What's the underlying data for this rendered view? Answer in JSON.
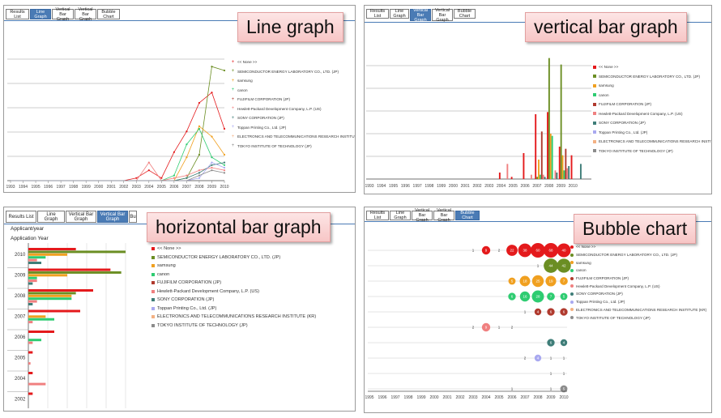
{
  "colors": {
    "tab_active": "#4a7bb5",
    "callout_bg": "#f9d2d2",
    "series": [
      "#e41a1c",
      "#6b8e23",
      "#f0a020",
      "#2ecc71",
      "#b03a2e",
      "#f08080",
      "#3e7d78",
      "#a9a9f0",
      "#f4b183",
      "#8c8c8c"
    ]
  },
  "panels": [
    {
      "tabs": [
        "Results List",
        "Line Graph",
        "Vertical Bar Graph",
        "Vertical Bar Graph",
        "Bubble Chart"
      ],
      "active_tab": 1,
      "callout": "Line graph"
    },
    {
      "tabs": [
        "Results List",
        "Line Graph",
        "Vertical Bar Graph",
        "Vertical Bar Graph",
        "Bubble Chart"
      ],
      "active_tab": 2,
      "callout": "vertical bar graph"
    },
    {
      "tabs": [
        "Results List",
        "Line Graph",
        "Vertical Bar Graph",
        "Vertical Bar Graph",
        "Bu"
      ],
      "active_tab": 3,
      "callout": "horizontal bar graph",
      "title1": "Applicant/year",
      "title2": "Application Year"
    },
    {
      "tabs": [
        "Results List",
        "Line Graph",
        "Vertical Bar Graph",
        "Vertical Bar Graph",
        "Bubble Chart"
      ],
      "active_tab": 4,
      "callout": "Bubble chart"
    }
  ],
  "legend": [
    "<< None >>",
    "SEMICONDUCTOR ENERGY LABORATORY CO., LTD. (JP)",
    "samsung",
    "canon",
    "FUJIFILM CORPORATION (JP)",
    "Hewlett-Packard Development Company, L.P. (US)",
    "SONY CORPORATION (JP)",
    "Toppan Printing Co., Ltd. (JP)",
    "ELECTRONICS AND TELECOMMUNICATIONS RESEARCH INSTITUTE (KR)",
    "TOKYO INSTITUTE OF TECHNOLOGY (JP)"
  ],
  "chart_data": [
    {
      "type": "line",
      "x": [
        "1993",
        "1994",
        "1995",
        "1996",
        "1997",
        "1998",
        "1999",
        "2000",
        "2001",
        "2002",
        "2003",
        "2004",
        "2005",
        "2006",
        "2007",
        "2008",
        "2009",
        "2010"
      ],
      "series": [
        {
          "name": "<< None >>",
          "values": [
            0,
            0,
            0,
            0,
            0,
            0,
            0,
            0,
            0,
            0,
            2,
            8,
            2,
            22,
            38,
            60,
            68,
            40
          ]
        },
        {
          "name": "SEMICONDUCTOR ENERGY LABORATORY CO., LTD. (JP)",
          "values": [
            0,
            0,
            0,
            0,
            0,
            0,
            0,
            0,
            0,
            0,
            0,
            0,
            0,
            0,
            2,
            20,
            88,
            85
          ]
        },
        {
          "name": "samsung",
          "values": [
            0,
            0,
            0,
            0,
            0,
            0,
            0,
            0,
            0,
            0,
            0,
            0,
            0,
            0,
            18,
            42,
            34,
            20
          ]
        },
        {
          "name": "canon",
          "values": [
            0,
            0,
            0,
            0,
            0,
            0,
            0,
            0,
            0,
            0,
            0,
            0,
            0,
            4,
            28,
            40,
            18,
            12
          ]
        },
        {
          "name": "Hewlett-Packard Development Company, L.P. (US)",
          "values": [
            0,
            0,
            0,
            0,
            0,
            0,
            0,
            0,
            0,
            0,
            0,
            14,
            0,
            2,
            4,
            8,
            10,
            8
          ]
        },
        {
          "name": "SONY CORPORATION (JP)",
          "values": [
            0,
            0,
            0,
            0,
            0,
            0,
            0,
            0,
            0,
            0,
            0,
            0,
            0,
            0,
            2,
            6,
            12,
            14
          ]
        },
        {
          "name": "Toppan Printing Co., Ltd. (JP)",
          "values": [
            0,
            0,
            0,
            0,
            0,
            0,
            0,
            0,
            0,
            0,
            0,
            0,
            0,
            0,
            0,
            2,
            14,
            10
          ]
        },
        {
          "name": "TOKYO INSTITUTE OF TECHNOLOGY (JP)",
          "values": [
            0,
            0,
            0,
            0,
            0,
            0,
            0,
            0,
            0,
            0,
            0,
            0,
            0,
            0,
            0,
            4,
            8,
            6
          ]
        }
      ]
    },
    {
      "type": "bar",
      "x": [
        "1993",
        "1994",
        "1995",
        "1996",
        "1997",
        "1998",
        "1999",
        "2000",
        "2001",
        "2002",
        "2003",
        "2004",
        "2005",
        "2006",
        "2007",
        "2008",
        "2009",
        "2010"
      ],
      "series": [
        {
          "name": "<< None >>",
          "values": [
            0,
            0,
            0,
            0,
            0,
            0,
            0,
            0,
            0,
            0,
            0,
            6,
            2,
            24,
            60,
            62,
            30,
            22
          ]
        },
        {
          "name": "SEMICONDUCTOR ENERGY LABORATORY CO., LTD. (JP)",
          "values": [
            0,
            0,
            0,
            0,
            0,
            0,
            0,
            0,
            0,
            0,
            0,
            0,
            0,
            0,
            2,
            112,
            106,
            0
          ]
        },
        {
          "name": "samsung",
          "values": [
            0,
            0,
            0,
            0,
            0,
            0,
            0,
            0,
            0,
            0,
            0,
            0,
            0,
            0,
            18,
            42,
            22,
            0
          ]
        },
        {
          "name": "canon",
          "values": [
            0,
            0,
            0,
            0,
            0,
            0,
            0,
            0,
            0,
            0,
            0,
            0,
            0,
            0,
            4,
            40,
            8,
            0
          ]
        },
        {
          "name": "FUJIFILM CORPORATION (JP)",
          "values": [
            0,
            0,
            0,
            0,
            0,
            0,
            0,
            0,
            0,
            0,
            0,
            0,
            0,
            0,
            44,
            0,
            28,
            0
          ]
        },
        {
          "name": "Hewlett-Packard Development Company, L.P. (US)",
          "values": [
            0,
            0,
            0,
            0,
            0,
            0,
            0,
            0,
            0,
            0,
            0,
            14,
            0,
            4,
            4,
            8,
            10,
            0
          ]
        },
        {
          "name": "SONY CORPORATION (JP)",
          "values": [
            0,
            0,
            0,
            0,
            0,
            0,
            0,
            0,
            0,
            0,
            0,
            0,
            0,
            0,
            2,
            6,
            12,
            14
          ]
        }
      ]
    },
    {
      "type": "bar",
      "orientation": "horizontal",
      "categories": [
        "2010",
        "2009",
        "2008",
        "2007",
        "2006",
        "2005",
        "2004",
        "2002"
      ],
      "series": [
        {
          "name": "<< None >>",
          "values": [
            22,
            38,
            30,
            24,
            12,
            2,
            2,
            2
          ]
        },
        {
          "name": "SEMICONDUCTOR ENERGY LABORATORY CO., LTD. (JP)",
          "values": [
            45,
            43,
            22,
            0,
            0,
            0,
            0,
            0
          ]
        },
        {
          "name": "samsung",
          "values": [
            18,
            18,
            20,
            8,
            0,
            0,
            0,
            0
          ]
        },
        {
          "name": "canon",
          "values": [
            8,
            4,
            20,
            12,
            6,
            0,
            0,
            0
          ]
        },
        {
          "name": "Hewlett-Packard Development Company, L.P. (US)",
          "values": [
            4,
            4,
            4,
            2,
            2,
            1,
            8,
            0
          ]
        },
        {
          "name": "SONY CORPORATION (JP)",
          "values": [
            6,
            2,
            2,
            0,
            0,
            0,
            0,
            0
          ]
        }
      ]
    },
    {
      "type": "scatter",
      "subtype": "bubble",
      "x": [
        "1995",
        "1996",
        "1997",
        "1998",
        "1999",
        "2000",
        "2001",
        "2002",
        "2003",
        "2004",
        "2005",
        "2006",
        "2007",
        "2008",
        "2009",
        "2010"
      ],
      "rows": [
        {
          "name": "<< None >>",
          "points": [
            [
              "2003",
              1
            ],
            [
              "2004",
              9
            ],
            [
              "2005",
              2
            ],
            [
              "2006",
              22
            ],
            [
              "2007",
              38
            ],
            [
              "2008",
              60
            ],
            [
              "2009",
              68
            ],
            [
              "2010",
              40
            ]
          ]
        },
        {
          "name": "SEMICONDUCTOR ENERGY LABORATORY CO., LTD. (JP)",
          "points": [
            [
              "2008",
              1
            ],
            [
              "2009",
              44
            ],
            [
              "2010",
              42
            ]
          ]
        },
        {
          "name": "samsung",
          "points": [
            [
              "2006",
              5
            ],
            [
              "2007",
              18
            ],
            [
              "2008",
              25
            ],
            [
              "2009",
              19
            ],
            [
              "2010",
              7
            ]
          ]
        },
        {
          "name": "canon",
          "points": [
            [
              "2006",
              6
            ],
            [
              "2007",
              16
            ],
            [
              "2008",
              28
            ],
            [
              "2009",
              7
            ],
            [
              "2010",
              5
            ]
          ]
        },
        {
          "name": "FUJIFILM CORPORATION (JP)",
          "points": [
            [
              "2007",
              1
            ],
            [
              "2008",
              4
            ],
            [
              "2009",
              6
            ],
            [
              "2010",
              6
            ]
          ]
        },
        {
          "name": "Hewlett-Packard Development Company, L.P. (US)",
          "points": [
            [
              "2003",
              2
            ],
            [
              "2004",
              9
            ],
            [
              "2005",
              1
            ],
            [
              "2006",
              2
            ]
          ]
        },
        {
          "name": "SONY CORPORATION (JP)",
          "points": [
            [
              "2009",
              6
            ],
            [
              "2010",
              4
            ]
          ]
        },
        {
          "name": "Toppan Printing Co., Ltd. (JP)",
          "points": [
            [
              "2007",
              2
            ],
            [
              "2008",
              4
            ],
            [
              "2009",
              1
            ],
            [
              "2010",
              1
            ]
          ]
        },
        {
          "name": "ELECTRONICS AND TELECOMMUNICATIONS RESEARCH INSTITUTE (KR)",
          "points": [
            [
              "2009",
              1
            ],
            [
              "2010",
              1
            ]
          ]
        },
        {
          "name": "TOKYO INSTITUTE OF TECHNOLOGY (JP)",
          "points": [
            [
              "2006",
              1
            ],
            [
              "2009",
              1
            ],
            [
              "2010",
              5
            ]
          ]
        }
      ]
    }
  ]
}
